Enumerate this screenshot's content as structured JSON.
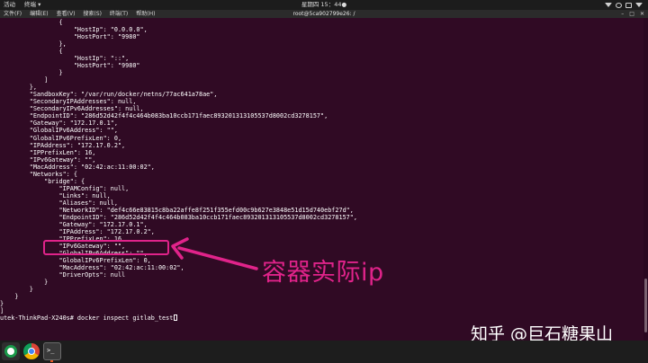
{
  "topbar": {
    "activities": "活动",
    "app": "终端 ▾",
    "clock": "星期四 15：44●"
  },
  "window": {
    "menus": [
      "文件(F)",
      "编辑(E)",
      "查看(V)",
      "搜索(S)",
      "终端(T)",
      "帮助(H)"
    ],
    "title": "root@5ca902799e26: /",
    "controls": [
      "–",
      "□",
      "✕"
    ]
  },
  "terminal": {
    "lines": [
      "                {",
      "                    \"HostIp\": \"0.0.0.0\",",
      "                    \"HostPort\": \"9980\"",
      "                },",
      "                {",
      "                    \"HostIp\": \"::\",",
      "                    \"HostPort\": \"9980\"",
      "                }",
      "            ]",
      "        },",
      "        \"SandboxKey\": \"/var/run/docker/netns/77ac641a78ae\",",
      "        \"SecondaryIPAddresses\": null,",
      "        \"SecondaryIPv6Addresses\": null,",
      "        \"EndpointID\": \"286d52d42f4f4c464b083ba10ccb171faec893201313105537d8002cd3278157\",",
      "        \"Gateway\": \"172.17.0.1\",",
      "        \"GlobalIPv6Address\": \"\",",
      "        \"GlobalIPv6PrefixLen\": 0,",
      "        \"IPAddress\": \"172.17.0.2\",",
      "        \"IPPrefixLen\": 16,",
      "        \"IPv6Gateway\": \"\",",
      "        \"MacAddress\": \"02:42:ac:11:00:02\",",
      "        \"Networks\": {",
      "            \"bridge\": {",
      "                \"IPAMConfig\": null,",
      "                \"Links\": null,",
      "                \"Aliases\": null,",
      "                \"NetworkID\": \"def4c66e83815c8ba22affe8f251f355efd00c9b627e3848e51d15d740ebf27d\",",
      "                \"EndpointID\": \"286d52d42f4f4c464b083ba10ccb171faec893201313105537d8002cd3278157\",",
      "                \"Gateway\": \"172.17.0.1\",",
      "                \"IPAddress\": \"172.17.0.2\",",
      "                \"IPPrefixLen\": 16,",
      "                \"IPv6Gateway\": \"\",",
      "                \"GlobalIPv6Address\": \"\",",
      "                \"GlobalIPv6PrefixLen\": 0,",
      "                \"MacAddress\": \"02:42:ac:11:00:02\",",
      "                \"DriverOpts\": null",
      "            }",
      "        }",
      "    }",
      "}",
      "]",
      "utek-ThinkPad-X240s# docker inspect gitlab_test"
    ]
  },
  "annotation": {
    "label": "容器实际ip",
    "color": "#e0238a"
  },
  "watermark": "知乎 @巨石糖果山",
  "taskbar": {
    "icons": [
      "gitkraken-icon",
      "chrome-icon",
      "terminal-icon"
    ],
    "terminal_glyph": ">_"
  }
}
